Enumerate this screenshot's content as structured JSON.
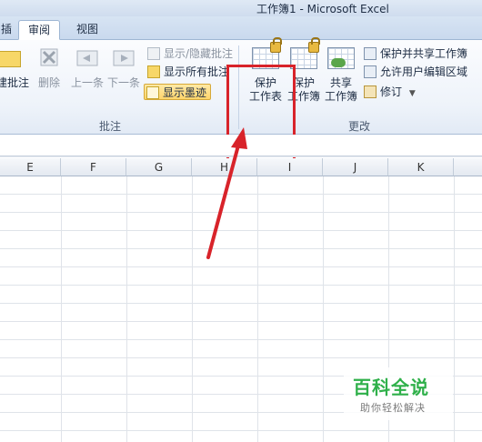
{
  "window": {
    "title": "工作簿1 - Microsoft Excel"
  },
  "tabs": {
    "cut_label": "插",
    "active_label": "审阅",
    "view_label": "视图"
  },
  "ribbon": {
    "comments_group": {
      "label": "批注",
      "new_comment": "建批注",
      "delete": "删除",
      "previous": "上一条",
      "next": "下一条",
      "show_hide": "显示/隐藏批注",
      "show_all": "显示所有批注",
      "show_ink": "显示墨迹"
    },
    "changes_group": {
      "label": "更改",
      "protect_sheet": [
        "保护",
        "工作表"
      ],
      "protect_workbook": [
        "保护",
        "工作簿"
      ],
      "share_workbook": [
        "共享",
        "工作簿"
      ],
      "protect_and_share": "保护并共享工作簿",
      "allow_edit_ranges": "允许用户编辑区域",
      "track_changes": "修订"
    }
  },
  "columns": [
    "E",
    "F",
    "G",
    "H",
    "I",
    "J",
    "K"
  ],
  "watermark": {
    "main": "百科全说",
    "sub": "助你轻松解决"
  },
  "colors": {
    "highlight": "#d8232a",
    "watermark": "#2fb04a"
  }
}
